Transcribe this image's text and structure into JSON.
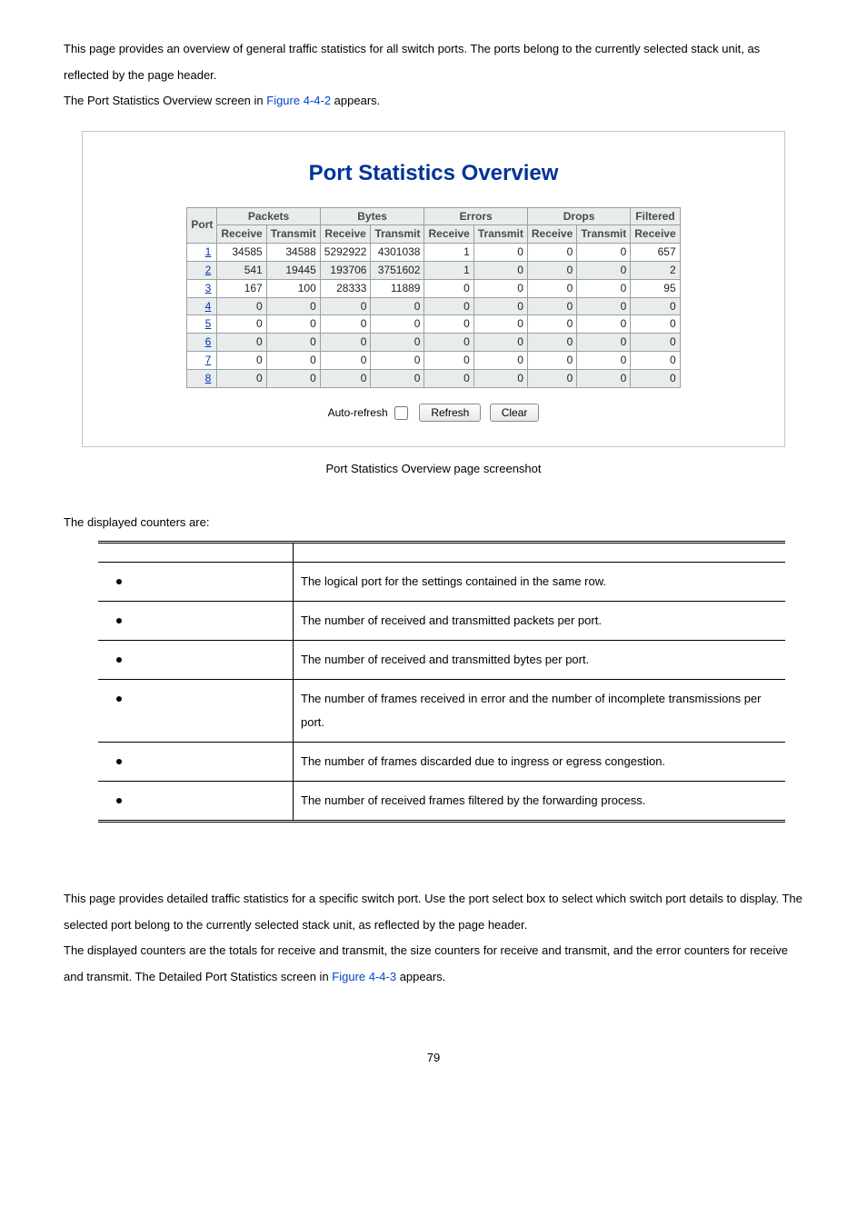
{
  "intro": {
    "p1a": "This page provides an overview of general traffic statistics for all switch ports. The ports belong to the currently selected stack unit, as reflected by the page header.",
    "p2a": "The Port Statistics Overview screen in ",
    "figref1": "Figure 4-4-2",
    "p2b": " appears."
  },
  "chart_data": {
    "type": "table",
    "title": "Port Statistics Overview",
    "header_groups": [
      {
        "label": "Port",
        "span": 1
      },
      {
        "label": "Packets",
        "span": 2
      },
      {
        "label": "Bytes",
        "span": 2
      },
      {
        "label": "Errors",
        "span": 2
      },
      {
        "label": "Drops",
        "span": 2
      },
      {
        "label": "Filtered",
        "span": 1
      }
    ],
    "sub_headers": [
      "Receive",
      "Transmit",
      "Receive",
      "Transmit",
      "Receive",
      "Transmit",
      "Receive",
      "Transmit",
      "Receive"
    ],
    "rows": [
      {
        "port": "1",
        "pkt_rx": "34585",
        "pkt_tx": "34588",
        "byt_rx": "5292922",
        "byt_tx": "4301038",
        "err_rx": "1",
        "err_tx": "0",
        "drp_rx": "0",
        "drp_tx": "0",
        "flt_rx": "657"
      },
      {
        "port": "2",
        "pkt_rx": "541",
        "pkt_tx": "19445",
        "byt_rx": "193706",
        "byt_tx": "3751602",
        "err_rx": "1",
        "err_tx": "0",
        "drp_rx": "0",
        "drp_tx": "0",
        "flt_rx": "2"
      },
      {
        "port": "3",
        "pkt_rx": "167",
        "pkt_tx": "100",
        "byt_rx": "28333",
        "byt_tx": "11889",
        "err_rx": "0",
        "err_tx": "0",
        "drp_rx": "0",
        "drp_tx": "0",
        "flt_rx": "95"
      },
      {
        "port": "4",
        "pkt_rx": "0",
        "pkt_tx": "0",
        "byt_rx": "0",
        "byt_tx": "0",
        "err_rx": "0",
        "err_tx": "0",
        "drp_rx": "0",
        "drp_tx": "0",
        "flt_rx": "0"
      },
      {
        "port": "5",
        "pkt_rx": "0",
        "pkt_tx": "0",
        "byt_rx": "0",
        "byt_tx": "0",
        "err_rx": "0",
        "err_tx": "0",
        "drp_rx": "0",
        "drp_tx": "0",
        "flt_rx": "0"
      },
      {
        "port": "6",
        "pkt_rx": "0",
        "pkt_tx": "0",
        "byt_rx": "0",
        "byt_tx": "0",
        "err_rx": "0",
        "err_tx": "0",
        "drp_rx": "0",
        "drp_tx": "0",
        "flt_rx": "0"
      },
      {
        "port": "7",
        "pkt_rx": "0",
        "pkt_tx": "0",
        "byt_rx": "0",
        "byt_tx": "0",
        "err_rx": "0",
        "err_tx": "0",
        "drp_rx": "0",
        "drp_tx": "0",
        "flt_rx": "0"
      },
      {
        "port": "8",
        "pkt_rx": "0",
        "pkt_tx": "0",
        "byt_rx": "0",
        "byt_tx": "0",
        "err_rx": "0",
        "err_tx": "0",
        "drp_rx": "0",
        "drp_tx": "0",
        "flt_rx": "0"
      }
    ],
    "controls": {
      "auto_refresh_label": "Auto-refresh",
      "refresh_btn": "Refresh",
      "clear_btn": "Clear"
    }
  },
  "caption": "Port Statistics Overview page screenshot",
  "counters_intro": "The displayed counters are:",
  "counters_table": {
    "header_obj": "",
    "header_desc": "",
    "rows": [
      {
        "obj": "",
        "desc": "The logical port for the settings contained in the same row."
      },
      {
        "obj": "",
        "desc": "The number of received and transmitted packets per port."
      },
      {
        "obj": "",
        "desc": "The number of received and transmitted bytes per port."
      },
      {
        "obj": "",
        "desc": "The number of frames received in error and the number of incomplete transmissions per port."
      },
      {
        "obj": "",
        "desc": "The number of frames discarded due to ingress or egress congestion."
      },
      {
        "obj": "",
        "desc": "The number of received frames filtered by the forwarding process."
      }
    ]
  },
  "section2": {
    "p1": "This page provides detailed traffic statistics for a specific switch port. Use the port select box to select which switch port details to display. The selected port belong to the currently selected stack unit, as reflected by the page header.",
    "p2a": "The displayed counters are the totals for receive and transmit, the size counters for receive and transmit, and the error counters for receive and transmit. The Detailed Port Statistics screen in ",
    "figref2": "Figure 4-4-3",
    "p2b": " appears."
  },
  "page_number": "79"
}
